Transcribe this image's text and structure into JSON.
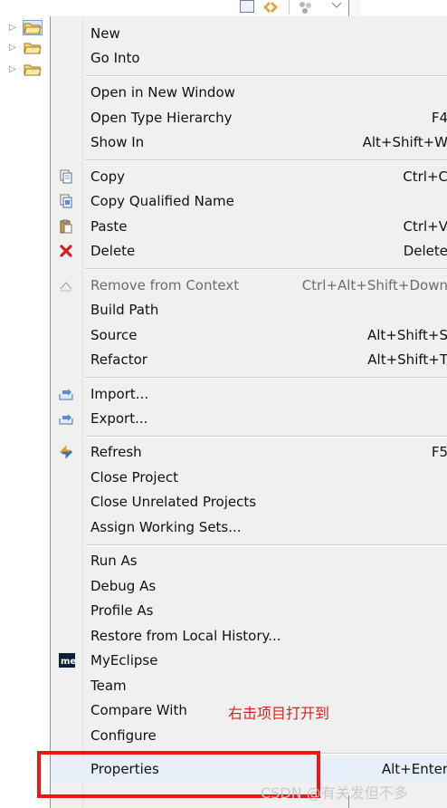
{
  "menu": {
    "items": [
      {
        "label": "New",
        "accel": "",
        "icon": ""
      },
      {
        "label": "Go Into",
        "accel": "",
        "icon": ""
      },
      {
        "label": "Open in New Window",
        "accel": "",
        "icon": ""
      },
      {
        "label": "Open Type Hierarchy",
        "accel": "F4",
        "icon": ""
      },
      {
        "label": "Show In",
        "accel": "Alt+Shift+W",
        "icon": ""
      },
      {
        "label": "Copy",
        "accel": "Ctrl+C",
        "icon": "copy-icon"
      },
      {
        "label": "Copy Qualified Name",
        "accel": "",
        "icon": "copy-qualified-name-icon"
      },
      {
        "label": "Paste",
        "accel": "Ctrl+V",
        "icon": "paste-icon"
      },
      {
        "label": "Delete",
        "accel": "Delete",
        "icon": "delete-icon"
      },
      {
        "label": "Remove from Context",
        "accel": "Ctrl+Alt+Shift+Down",
        "icon": "remove-from-context-icon",
        "disabled": true
      },
      {
        "label": "Build Path",
        "accel": "",
        "icon": ""
      },
      {
        "label": "Source",
        "accel": "Alt+Shift+S",
        "icon": ""
      },
      {
        "label": "Refactor",
        "accel": "Alt+Shift+T",
        "icon": ""
      },
      {
        "label": "Import...",
        "accel": "",
        "icon": "import-icon"
      },
      {
        "label": "Export...",
        "accel": "",
        "icon": "export-icon"
      },
      {
        "label": "Refresh",
        "accel": "F5",
        "icon": "refresh-icon"
      },
      {
        "label": "Close Project",
        "accel": "",
        "icon": ""
      },
      {
        "label": "Close Unrelated Projects",
        "accel": "",
        "icon": ""
      },
      {
        "label": "Assign Working Sets...",
        "accel": "",
        "icon": ""
      },
      {
        "label": "Run As",
        "accel": "",
        "icon": ""
      },
      {
        "label": "Debug As",
        "accel": "",
        "icon": ""
      },
      {
        "label": "Profile As",
        "accel": "",
        "icon": ""
      },
      {
        "label": "Restore from Local History...",
        "accel": "",
        "icon": ""
      },
      {
        "label": "MyEclipse",
        "accel": "",
        "icon": "myeclipse-icon"
      },
      {
        "label": "Team",
        "accel": "",
        "icon": ""
      },
      {
        "label": "Compare With",
        "accel": "",
        "icon": ""
      },
      {
        "label": "Configure",
        "accel": "",
        "icon": ""
      },
      {
        "label": "Properties",
        "accel": "Alt+Enter",
        "icon": "",
        "highlighted": true
      }
    ]
  },
  "annotation": {
    "text": "右击项目打开到",
    "watermark": "CSDN @有关发但不多"
  },
  "colors": {
    "menu_bg": "#f0f0f0",
    "highlight_bg": "#e6eef9",
    "annotation_red": "#e81818",
    "disabled_text": "#6d6d6d"
  },
  "tree": {
    "nodes": [
      {
        "icon": "project-folder-icon",
        "selected": true
      },
      {
        "icon": "project-folder-icon",
        "selected": false
      },
      {
        "icon": "project-folder-icon",
        "selected": false
      }
    ]
  }
}
